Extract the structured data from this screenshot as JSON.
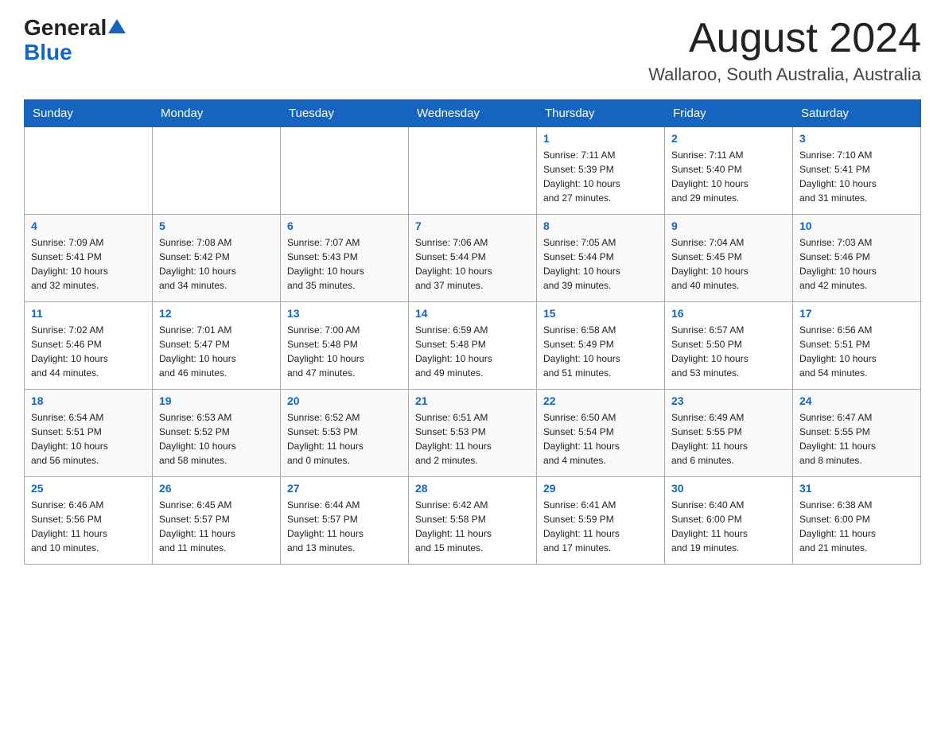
{
  "header": {
    "logo_general": "General",
    "logo_blue": "Blue",
    "month_year": "August 2024",
    "location": "Wallaroo, South Australia, Australia"
  },
  "weekdays": [
    "Sunday",
    "Monday",
    "Tuesday",
    "Wednesday",
    "Thursday",
    "Friday",
    "Saturday"
  ],
  "weeks": [
    [
      {
        "day": "",
        "info": ""
      },
      {
        "day": "",
        "info": ""
      },
      {
        "day": "",
        "info": ""
      },
      {
        "day": "",
        "info": ""
      },
      {
        "day": "1",
        "info": "Sunrise: 7:11 AM\nSunset: 5:39 PM\nDaylight: 10 hours\nand 27 minutes."
      },
      {
        "day": "2",
        "info": "Sunrise: 7:11 AM\nSunset: 5:40 PM\nDaylight: 10 hours\nand 29 minutes."
      },
      {
        "day": "3",
        "info": "Sunrise: 7:10 AM\nSunset: 5:41 PM\nDaylight: 10 hours\nand 31 minutes."
      }
    ],
    [
      {
        "day": "4",
        "info": "Sunrise: 7:09 AM\nSunset: 5:41 PM\nDaylight: 10 hours\nand 32 minutes."
      },
      {
        "day": "5",
        "info": "Sunrise: 7:08 AM\nSunset: 5:42 PM\nDaylight: 10 hours\nand 34 minutes."
      },
      {
        "day": "6",
        "info": "Sunrise: 7:07 AM\nSunset: 5:43 PM\nDaylight: 10 hours\nand 35 minutes."
      },
      {
        "day": "7",
        "info": "Sunrise: 7:06 AM\nSunset: 5:44 PM\nDaylight: 10 hours\nand 37 minutes."
      },
      {
        "day": "8",
        "info": "Sunrise: 7:05 AM\nSunset: 5:44 PM\nDaylight: 10 hours\nand 39 minutes."
      },
      {
        "day": "9",
        "info": "Sunrise: 7:04 AM\nSunset: 5:45 PM\nDaylight: 10 hours\nand 40 minutes."
      },
      {
        "day": "10",
        "info": "Sunrise: 7:03 AM\nSunset: 5:46 PM\nDaylight: 10 hours\nand 42 minutes."
      }
    ],
    [
      {
        "day": "11",
        "info": "Sunrise: 7:02 AM\nSunset: 5:46 PM\nDaylight: 10 hours\nand 44 minutes."
      },
      {
        "day": "12",
        "info": "Sunrise: 7:01 AM\nSunset: 5:47 PM\nDaylight: 10 hours\nand 46 minutes."
      },
      {
        "day": "13",
        "info": "Sunrise: 7:00 AM\nSunset: 5:48 PM\nDaylight: 10 hours\nand 47 minutes."
      },
      {
        "day": "14",
        "info": "Sunrise: 6:59 AM\nSunset: 5:48 PM\nDaylight: 10 hours\nand 49 minutes."
      },
      {
        "day": "15",
        "info": "Sunrise: 6:58 AM\nSunset: 5:49 PM\nDaylight: 10 hours\nand 51 minutes."
      },
      {
        "day": "16",
        "info": "Sunrise: 6:57 AM\nSunset: 5:50 PM\nDaylight: 10 hours\nand 53 minutes."
      },
      {
        "day": "17",
        "info": "Sunrise: 6:56 AM\nSunset: 5:51 PM\nDaylight: 10 hours\nand 54 minutes."
      }
    ],
    [
      {
        "day": "18",
        "info": "Sunrise: 6:54 AM\nSunset: 5:51 PM\nDaylight: 10 hours\nand 56 minutes."
      },
      {
        "day": "19",
        "info": "Sunrise: 6:53 AM\nSunset: 5:52 PM\nDaylight: 10 hours\nand 58 minutes."
      },
      {
        "day": "20",
        "info": "Sunrise: 6:52 AM\nSunset: 5:53 PM\nDaylight: 11 hours\nand 0 minutes."
      },
      {
        "day": "21",
        "info": "Sunrise: 6:51 AM\nSunset: 5:53 PM\nDaylight: 11 hours\nand 2 minutes."
      },
      {
        "day": "22",
        "info": "Sunrise: 6:50 AM\nSunset: 5:54 PM\nDaylight: 11 hours\nand 4 minutes."
      },
      {
        "day": "23",
        "info": "Sunrise: 6:49 AM\nSunset: 5:55 PM\nDaylight: 11 hours\nand 6 minutes."
      },
      {
        "day": "24",
        "info": "Sunrise: 6:47 AM\nSunset: 5:55 PM\nDaylight: 11 hours\nand 8 minutes."
      }
    ],
    [
      {
        "day": "25",
        "info": "Sunrise: 6:46 AM\nSunset: 5:56 PM\nDaylight: 11 hours\nand 10 minutes."
      },
      {
        "day": "26",
        "info": "Sunrise: 6:45 AM\nSunset: 5:57 PM\nDaylight: 11 hours\nand 11 minutes."
      },
      {
        "day": "27",
        "info": "Sunrise: 6:44 AM\nSunset: 5:57 PM\nDaylight: 11 hours\nand 13 minutes."
      },
      {
        "day": "28",
        "info": "Sunrise: 6:42 AM\nSunset: 5:58 PM\nDaylight: 11 hours\nand 15 minutes."
      },
      {
        "day": "29",
        "info": "Sunrise: 6:41 AM\nSunset: 5:59 PM\nDaylight: 11 hours\nand 17 minutes."
      },
      {
        "day": "30",
        "info": "Sunrise: 6:40 AM\nSunset: 6:00 PM\nDaylight: 11 hours\nand 19 minutes."
      },
      {
        "day": "31",
        "info": "Sunrise: 6:38 AM\nSunset: 6:00 PM\nDaylight: 11 hours\nand 21 minutes."
      }
    ]
  ]
}
